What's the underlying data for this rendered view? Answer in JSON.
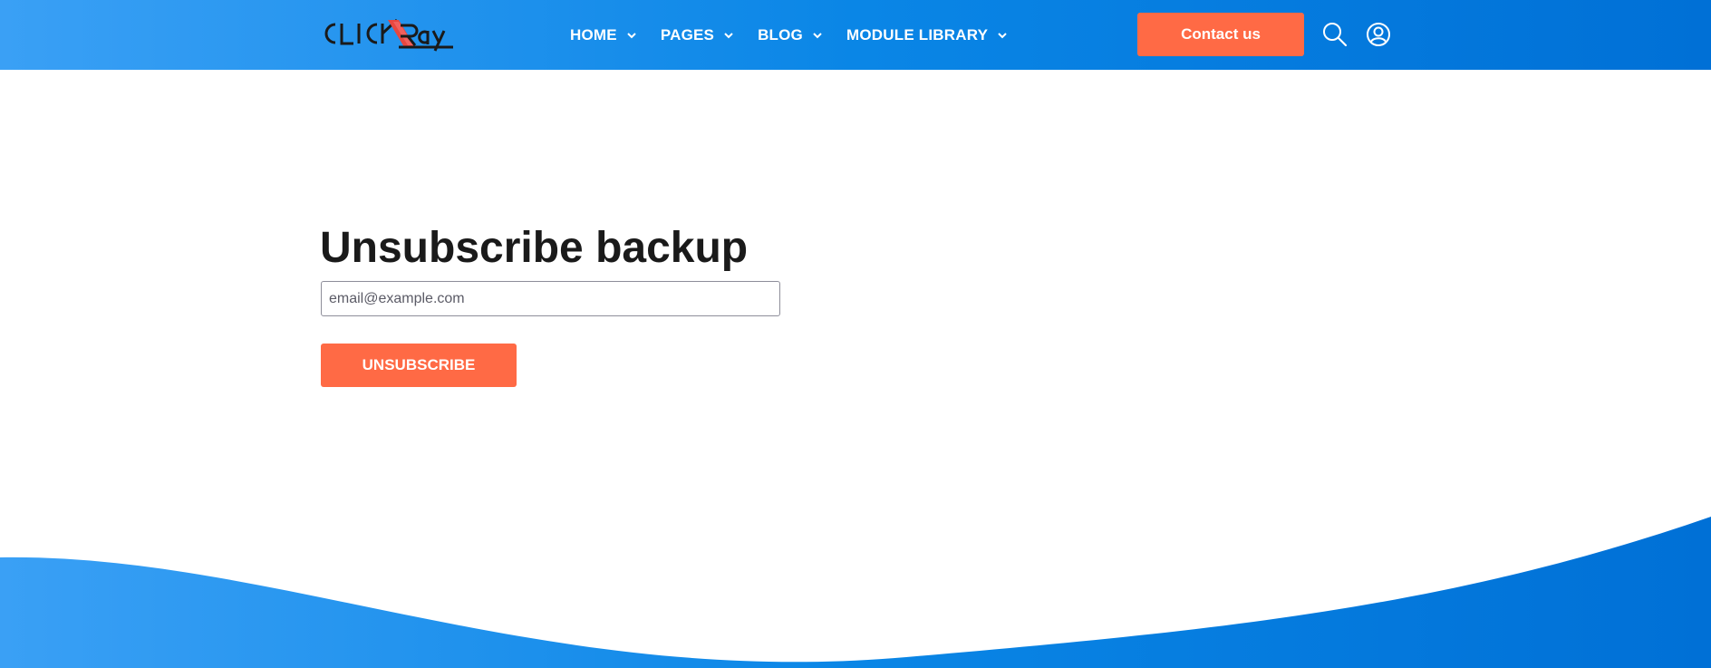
{
  "header": {
    "logo_text": "CLICKRay",
    "nav": [
      {
        "label": "HOME"
      },
      {
        "label": "PAGES"
      },
      {
        "label": "BLOG"
      },
      {
        "label": "MODULE LIBRARY"
      }
    ],
    "contact_label": "Contact us",
    "icons": [
      "search-icon",
      "user-icon"
    ]
  },
  "main": {
    "title": "Unsubscribe backup",
    "email_placeholder": "email@example.com",
    "email_value": "",
    "unsubscribe_label": "UNSUBSCRIBE"
  },
  "colors": {
    "header_gradient_start": "#3aa0f5",
    "header_gradient_end": "#0070d6",
    "accent": "#ff6a45",
    "title_text": "#1a1a1a"
  }
}
